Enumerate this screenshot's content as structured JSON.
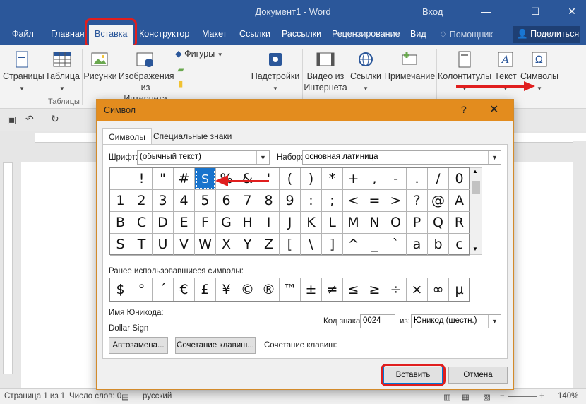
{
  "window": {
    "title": "Документ1 - Word",
    "signin": "Вход",
    "minimize": "—",
    "maximize": "☐",
    "close": "✕"
  },
  "ribbon_tabs": [
    "Файл",
    "Главная",
    "Вставка",
    "Конструктор",
    "Макет",
    "Ссылки",
    "Рассылки",
    "Рецензирование",
    "Вид",
    "Помощник"
  ],
  "active_tab": "Вставка",
  "share_label": "Поделиться",
  "ribbon": {
    "pages": "Страницы",
    "table": "Таблица",
    "tables_group": "Таблицы",
    "pictures": "Рисунки",
    "online_pictures": "Изображения из Интернета",
    "shapes": "Фигуры",
    "addins": "Надстройки",
    "online_video": "Видео из Интернета",
    "links": "Ссылки",
    "comment": "Примечание",
    "header_footer": "Колонтитулы",
    "text": "Текст",
    "symbols": "Символы"
  },
  "dialog": {
    "title": "Символ",
    "help": "?",
    "close": "✕",
    "tabs": [
      "Символы",
      "Специальные знаки"
    ],
    "font_label": "Шрифт:",
    "font_value": "(обычный текст)",
    "subset_label": "Набор:",
    "subset_value": "основная латиница",
    "symbols": [
      [
        " ",
        "!",
        "\"",
        "#",
        "$",
        "%",
        "&",
        "'",
        "(",
        ")",
        "*",
        "+",
        ",",
        "-",
        ".",
        "/",
        "0"
      ],
      [
        "1",
        "2",
        "3",
        "4",
        "5",
        "6",
        "7",
        "8",
        "9",
        ":",
        ";",
        "<",
        "=",
        ">",
        "?",
        "@",
        "A"
      ],
      [
        "B",
        "C",
        "D",
        "E",
        "F",
        "G",
        "H",
        "I",
        "J",
        "K",
        "L",
        "M",
        "N",
        "O",
        "P",
        "Q",
        "R"
      ],
      [
        "S",
        "T",
        "U",
        "V",
        "W",
        "X",
        "Y",
        "Z",
        "[",
        "\\",
        "]",
        "^",
        "_",
        "`",
        "a",
        "b",
        "c"
      ]
    ],
    "selected_symbol": "$",
    "recent_label": "Ранее использовавшиеся символы:",
    "recent": [
      "$",
      "°",
      "´",
      "€",
      "£",
      "¥",
      "©",
      "®",
      "™",
      "±",
      "≠",
      "≤",
      "≥",
      "÷",
      "×",
      "∞",
      "µ"
    ],
    "unicode_name_label": "Имя Юникода:",
    "unicode_name": "Dollar Sign",
    "char_code_label": "Код знака:",
    "char_code": "0024",
    "from_label": "из:",
    "from_value": "Юникод (шестн.)",
    "autocorrect": "Автозамена...",
    "shortcut_key": "Сочетание клавиш...",
    "shortcut_label": "Сочетание клавиш:",
    "insert": "Вставить",
    "cancel": "Отмена"
  },
  "status": {
    "page": "Страница 1 из 1",
    "words": "Число слов: 0",
    "language": "русский",
    "zoom": "140%"
  },
  "colors": {
    "word_blue": "#2b579a",
    "dialog_title": "#e38c1e",
    "selection": "#1873cc",
    "annotation": "#e01e1e"
  }
}
